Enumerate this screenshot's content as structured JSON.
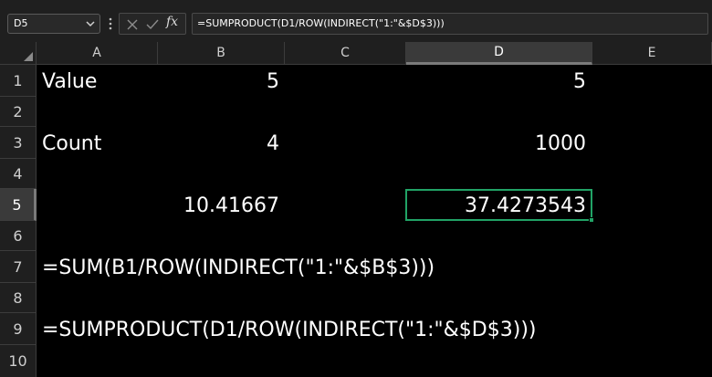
{
  "name_box": {
    "value": "D5"
  },
  "formula_bar": {
    "fx_symbol": "fx",
    "formula": "=SUMPRODUCT(D1/ROW(INDIRECT(\"1:\"&$D$3)))"
  },
  "columns": [
    "A",
    "B",
    "C",
    "D",
    "E"
  ],
  "rows": [
    "1",
    "2",
    "3",
    "4",
    "5",
    "6",
    "7",
    "8",
    "9",
    "10"
  ],
  "active_cell": {
    "column": "D",
    "row": "5"
  },
  "cells": {
    "A1": "Value",
    "B1": "5",
    "D1": "5",
    "A3": "Count",
    "B3": "4",
    "D3": "1000",
    "B5": "10.41667",
    "D5": "37.4273543",
    "A7": "=SUM(B1/ROW(INDIRECT(\"1:\"&$B$3)))",
    "A9": "=SUMPRODUCT(D1/ROW(INDIRECT(\"1:\"&$D$3)))"
  },
  "colors": {
    "selection": "#21a366",
    "header_bg": "#1f1f1f",
    "grid_bg": "#000000"
  }
}
